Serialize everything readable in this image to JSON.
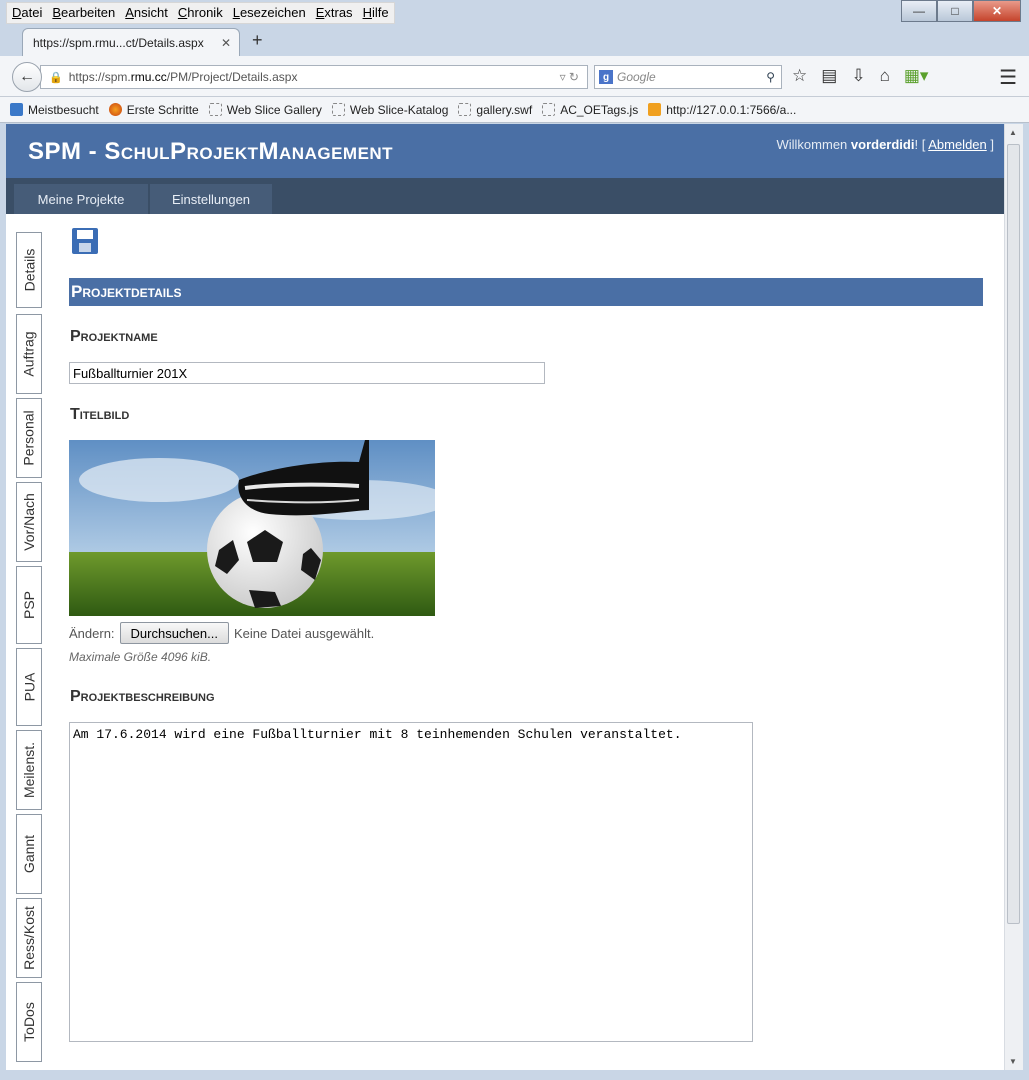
{
  "menubar": [
    "Datei",
    "Bearbeiten",
    "Ansicht",
    "Chronik",
    "Lesezeichen",
    "Extras",
    "Hilfe"
  ],
  "tab": {
    "title": "https://spm.rmu...ct/Details.aspx"
  },
  "url": {
    "prefix": "https://spm.",
    "host": "rmu.cc",
    "path": "/PM/Project/Details.aspx"
  },
  "search": {
    "placeholder": "Google"
  },
  "bookmarks": [
    "Meistbesucht",
    "Erste Schritte",
    "Web Slice Gallery",
    "Web Slice-Katalog",
    "gallery.swf",
    "AC_OETags.js",
    "http://127.0.0.1:7566/a..."
  ],
  "app": {
    "title": "SPM - SchulProjektManagement",
    "welcome_prefix": "Willkommen ",
    "user": "vorderdidi",
    "welcome_mid": "! [ ",
    "logout": "Abmelden",
    "welcome_suffix": " ]"
  },
  "nav": [
    "Meine Projekte",
    "Einstellungen"
  ],
  "sidetabs": [
    "Details",
    "Auftrag",
    "Personal",
    "Vor/Nach",
    "PSP",
    "PUA",
    "Meilenst.",
    "Gannt",
    "Ress/Kost",
    "ToDos"
  ],
  "form": {
    "section_title": "Projektdetails",
    "name_label": "Projektname",
    "name_value": "Fußballturnier 201X",
    "image_label": "Titelbild",
    "change_label": "Ändern:",
    "browse_button": "Durchsuchen...",
    "no_file": "Keine Datei ausgewählt.",
    "max_size": "Maximale Größe 4096 kiB.",
    "desc_label": "Projektbeschreibung",
    "desc_value": "Am 17.6.2014 wird eine Fußballturnier mit 8 teinhemenden Schulen veranstaltet."
  }
}
